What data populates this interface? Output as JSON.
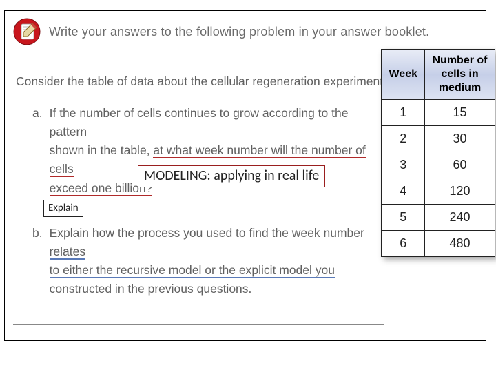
{
  "header": {
    "instruction": "Write your answers to the following problem in your answer booklet."
  },
  "intro": "Consider the table of data about the cellular regeneration experiment.",
  "questions": {
    "a": {
      "label": "a.",
      "line1": "If the number of cells continues to grow according to the pattern",
      "line2a": "shown in the table, ",
      "line2b": "at what week number will the number of cells",
      "line3": "exceed one billion?"
    },
    "b": {
      "label": "b.",
      "line1a": "Explain how the process you used to find the week number ",
      "line1b": "relates",
      "line2": "to either the recursive model or the explicit model you",
      "line3": "constructed in the previous questions."
    }
  },
  "annotations": {
    "modeling": "MODELING: applying in real life",
    "explain": "Explain"
  },
  "table": {
    "headers": {
      "week": "Week",
      "cells": "Number of cells in medium"
    },
    "rows": [
      {
        "week": "1",
        "cells": "15"
      },
      {
        "week": "2",
        "cells": "30"
      },
      {
        "week": "3",
        "cells": "60"
      },
      {
        "week": "4",
        "cells": "120"
      },
      {
        "week": "5",
        "cells": "240"
      },
      {
        "week": "6",
        "cells": "480"
      }
    ]
  },
  "chart_data": {
    "type": "table",
    "title": "Cellular regeneration experiment",
    "columns": [
      "Week",
      "Number of cells in medium"
    ],
    "rows": [
      [
        1,
        15
      ],
      [
        2,
        30
      ],
      [
        3,
        60
      ],
      [
        4,
        120
      ],
      [
        5,
        240
      ],
      [
        6,
        480
      ]
    ]
  }
}
